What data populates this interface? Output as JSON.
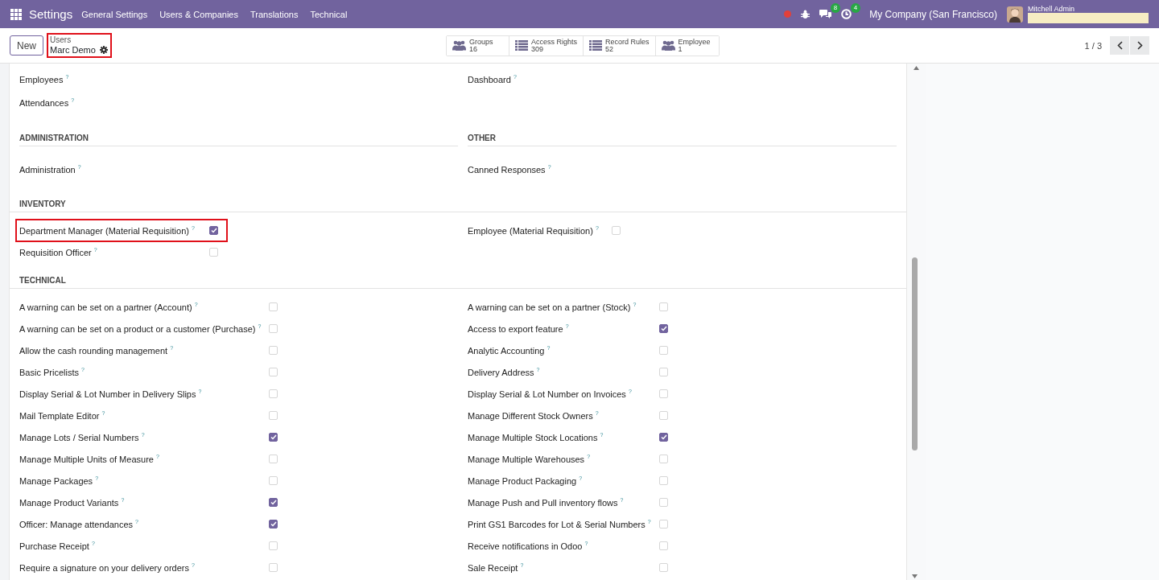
{
  "navbar": {
    "app": "Settings",
    "menus": [
      "General Settings",
      "Users & Companies",
      "Translations",
      "Technical"
    ],
    "messages_count": "8",
    "activities_count": "4",
    "company": "My Company (San Francisco)",
    "user": "Mitchell Admin"
  },
  "control_panel": {
    "new_button": "New",
    "breadcrumb": {
      "parent": "Users",
      "current": "Marc Demo",
      "highlighted": true
    },
    "stat_buttons": [
      {
        "kind": "users",
        "label": "Groups",
        "value": "16"
      },
      {
        "kind": "list",
        "label": "Access Rights",
        "value": "309"
      },
      {
        "kind": "list",
        "label": "Record Rules",
        "value": "52"
      },
      {
        "kind": "users",
        "label": "Employee",
        "value": "1"
      }
    ],
    "pager": "1 / 3"
  },
  "sections": [
    {
      "kind": "plain",
      "left": {
        "rows": [
          {
            "kind": "select",
            "label": "Employees $^{?}$"
          },
          {
            "kind": "select",
            "label": "Attendances $^{?}$"
          }
        ]
      },
      "right": {
        "rows": [
          {
            "kind": "select",
            "label": "Dashboard $^{?}$"
          }
        ]
      }
    },
    {
      "kind": "pair",
      "left": {
        "title": "ADMINISTRATION",
        "rows": [
          {
            "kind": "select",
            "label": "Administration $^{?}$"
          }
        ]
      },
      "right": {
        "title": "OTHER",
        "rows": [
          {
            "kind": "select",
            "label": "Canned Responses $^{?}$"
          }
        ]
      }
    },
    {
      "kind": "full",
      "title": "INVENTORY",
      "left": {
        "rows": [
          {
            "kind": "checkbox",
            "label": "Department Manager (Material Requisition) $^{?}$",
            "checked": true,
            "highlighted": true
          },
          {
            "kind": "checkbox",
            "label": "Requisition Officer $^{?}$",
            "checked": false,
            "highlighted": false
          }
        ]
      },
      "right": {
        "rows": [
          {
            "kind": "checkbox",
            "label": "Employee (Material Requisition) $^{?}$",
            "checked": false,
            "highlighted": false
          }
        ]
      }
    },
    {
      "kind": "full",
      "title": "TECHNICAL",
      "left": {
        "rows": [
          {
            "kind": "checkbox",
            "label": "A warning can be set on a partner (Account) $^{?}$",
            "checked": false,
            "highlighted": false
          },
          {
            "kind": "checkbox",
            "label": "A warning can be set on a product or a customer (Purchase) $^{?}$",
            "checked": false,
            "highlighted": false
          },
          {
            "kind": "checkbox",
            "label": "Allow the cash rounding management $^{?}$",
            "checked": false,
            "highlighted": false
          },
          {
            "kind": "checkbox",
            "label": "Basic Pricelists $^{?}$",
            "checked": false,
            "highlighted": false
          },
          {
            "kind": "checkbox",
            "label": "Display Serial & Lot Number in Delivery Slips $^{?}$",
            "checked": false,
            "highlighted": false
          },
          {
            "kind": "checkbox",
            "label": "Mail Template Editor $^{?}$",
            "checked": false,
            "highlighted": false
          },
          {
            "kind": "checkbox",
            "label": "Manage Lots / Serial Numbers $^{?}$",
            "checked": true,
            "highlighted": false
          },
          {
            "kind": "checkbox",
            "label": "Manage Multiple Units of Measure $^{?}$",
            "checked": false,
            "highlighted": false
          },
          {
            "kind": "checkbox",
            "label": "Manage Packages $^{?}$",
            "checked": false,
            "highlighted": false
          },
          {
            "kind": "checkbox",
            "label": "Manage Product Variants $^{?}$",
            "checked": true,
            "highlighted": false
          },
          {
            "kind": "checkbox",
            "label": "Officer: Manage attendances $^{?}$",
            "checked": true,
            "highlighted": false
          },
          {
            "kind": "checkbox",
            "label": "Purchase Receipt $^{?}$",
            "checked": false,
            "highlighted": false
          },
          {
            "kind": "checkbox",
            "label": "Require a signature on your delivery orders $^{?}$",
            "checked": false,
            "highlighted": false
          }
        ]
      },
      "right": {
        "rows": [
          {
            "kind": "checkbox",
            "label": "A warning can be set on a partner (Stock) $^{?}$",
            "checked": false,
            "highlighted": false
          },
          {
            "kind": "checkbox",
            "label": "Access to export feature $^{?}$",
            "checked": true,
            "highlighted": false
          },
          {
            "kind": "checkbox",
            "label": "Analytic Accounting $^{?}$",
            "checked": false,
            "highlighted": false
          },
          {
            "kind": "checkbox",
            "label": "Delivery Address $^{?}$",
            "checked": false,
            "highlighted": false
          },
          {
            "kind": "checkbox",
            "label": "Display Serial & Lot Number on Invoices $^{?}$",
            "checked": false,
            "highlighted": false
          },
          {
            "kind": "checkbox",
            "label": "Manage Different Stock Owners $^{?}$",
            "checked": false,
            "highlighted": false
          },
          {
            "kind": "checkbox",
            "label": "Manage Multiple Stock Locations $^{?}$",
            "checked": true,
            "highlighted": false
          },
          {
            "kind": "checkbox",
            "label": "Manage Multiple Warehouses $^{?}$",
            "checked": false,
            "highlighted": false
          },
          {
            "kind": "checkbox",
            "label": "Manage Product Packaging $^{?}$",
            "checked": false,
            "highlighted": false
          },
          {
            "kind": "checkbox",
            "label": "Manage Push and Pull inventory flows $^{?}$",
            "checked": false,
            "highlighted": false
          },
          {
            "kind": "checkbox",
            "label": "Print GS1 Barcodes for Lot & Serial Numbers $^{?}$",
            "checked": false,
            "highlighted": false
          },
          {
            "kind": "checkbox",
            "label": "Receive notifications in Odoo $^{?}$",
            "checked": false,
            "highlighted": false
          },
          {
            "kind": "checkbox",
            "label": "Sale Receipt $^{?}$",
            "checked": false,
            "highlighted": false
          }
        ]
      }
    }
  ]
}
